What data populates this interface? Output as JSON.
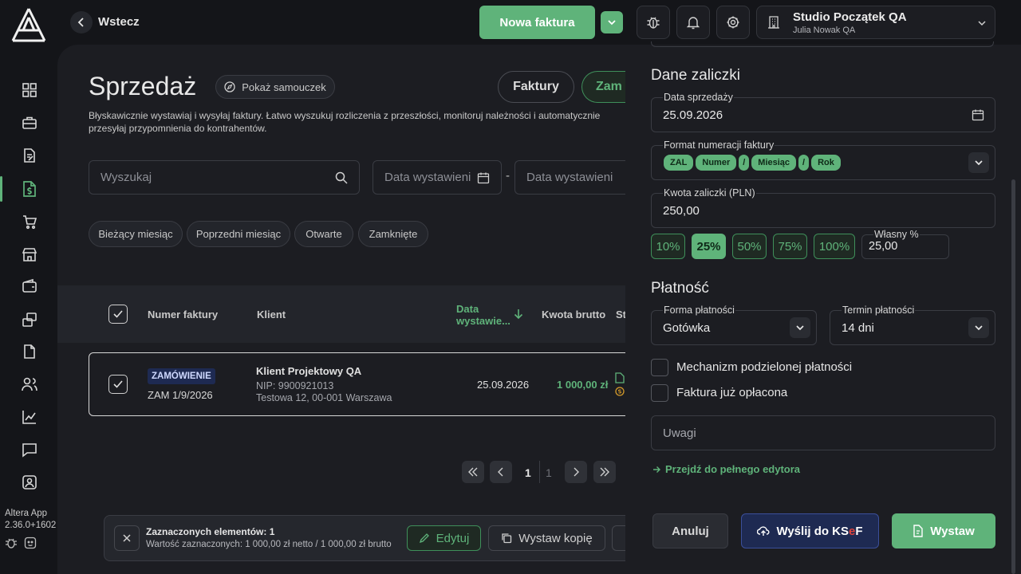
{
  "app": {
    "name": "Altera App",
    "version": "2.36.0+1602"
  },
  "header": {
    "back_label": "Wstecz",
    "new_invoice_label": "Nowa faktura",
    "org_name": "Studio Początek QA",
    "org_user": "Julia Nowak QA"
  },
  "page": {
    "title": "Sprzedaż",
    "tutorial_label": "Pokaż samouczek",
    "description": "Błyskawicznie wystawiaj i wysyłaj faktury. Łatwo wyszukuj rozliczenia z przeszłości, monitoruj należności i automatycznie przesyłaj przypomnienia do kontrahentów.",
    "tabs": [
      {
        "label": "Faktury"
      },
      {
        "label": "Zam"
      }
    ],
    "search_placeholder": "Wyszukaj",
    "date_from_placeholder": "Data wystawieni",
    "date_sep": "-",
    "date_to_placeholder": "Data wystawieni",
    "filters": [
      "Bieżący miesiąc",
      "Poprzedni miesiąc",
      "Otwarte",
      "Zamknięte"
    ]
  },
  "table": {
    "columns": {
      "number": "Numer faktury",
      "client": "Klient",
      "date_line1": "Data",
      "date_line2": "wystawie...",
      "gross": "Kwota brutto",
      "status": "St"
    },
    "rows": [
      {
        "badge": "ZAMÓWIENIE",
        "number": "ZAM 1/9/2026",
        "client_name": "Klient Projektowy QA",
        "nip": "NIP: 9900921013",
        "address": "Testowa 12, 00-001 Warszawa",
        "date": "25.09.2026",
        "gross": "1 000,00 zł"
      }
    ]
  },
  "pagination": {
    "current": "1",
    "total": "1"
  },
  "selection_bar": {
    "title": "Zaznaczonych elementów: 1",
    "subtitle": "Wartość zaznaczonych: 1 000,00 zł netto / 1 000,00 zł brutto",
    "edit_label": "Edytuj",
    "copy_label": "Wystaw kopię"
  },
  "drawer": {
    "section_advance": "Dane zaliczki",
    "sale_date_label": "Data sprzedaży",
    "sale_date_value": "25.09.2026",
    "numbering_label": "Format numeracji faktury",
    "numbering_chips": [
      "ZAL",
      "Numer",
      "/",
      "Miesiąc",
      "/",
      "Rok"
    ],
    "amount_label": "Kwota zaliczki (PLN)",
    "amount_value": "250,00",
    "percents": [
      "10%",
      "25%",
      "50%",
      "75%",
      "100%"
    ],
    "selected_percent": "25%",
    "own_percent_label": "Własny %",
    "own_percent_value": "25,00",
    "section_payment": "Płatność",
    "payment_form_label": "Forma płatności",
    "payment_form_value": "Gotówka",
    "payment_term_label": "Termin płatności",
    "payment_term_value": "14 dni",
    "split_payment_label": "Mechanizm podzielonej płatności",
    "paid_label": "Faktura już opłacona",
    "notes_placeholder": "Uwagi",
    "full_editor_link": "Przejdź do pełnego edytora",
    "cancel_label": "Anuluj",
    "ksef_label_prefix": "Wyślij do KS",
    "ksef_label_e": "e",
    "ksef_label_suffix": "F",
    "issue_label": "Wystaw"
  },
  "colors": {
    "accent": "#5fb37a",
    "bg": "#141519",
    "panel": "#1c1d22",
    "ksef": "#1e2a52"
  }
}
